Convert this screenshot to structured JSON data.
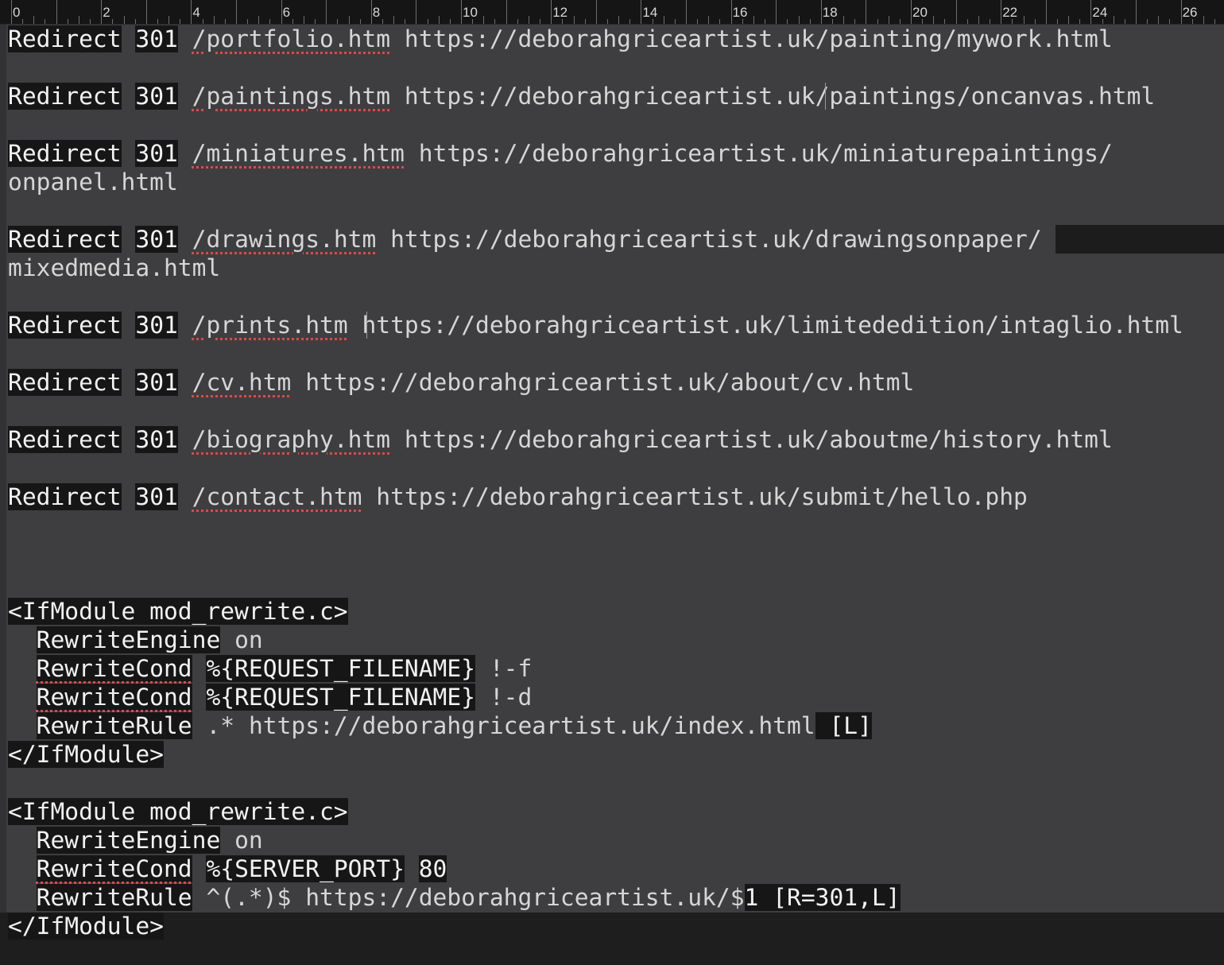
{
  "ruler": {
    "labels": [
      "0",
      "2",
      "4",
      "6",
      "8",
      "10",
      "12",
      "14",
      "16",
      "18",
      "20",
      "22",
      "24",
      "26"
    ]
  },
  "redirects": [
    {
      "keyword": "Redirect",
      "code": "301",
      "path": "/portfolio.htm",
      "url": "https://deborahgriceartist.uk/painting/mywork.html"
    },
    {
      "keyword": "Redirect",
      "code": "301",
      "path": "/paintings.htm",
      "url": "https://deborahgriceartist.uk/paintings/oncanvas.html"
    },
    {
      "keyword": "Redirect",
      "code": "301",
      "path": "/miniatures.htm",
      "url": "https://deborahgriceartist.uk/miniaturepaintings/",
      "wrap": "onpanel.html"
    },
    {
      "keyword": "Redirect",
      "code": "301",
      "path": "/drawings.htm",
      "url": "https://deborahgriceartist.uk/drawingsonpaper/",
      "wrap": "mixedmedia.html"
    },
    {
      "keyword": "Redirect",
      "code": "301",
      "path": "/prints.htm",
      "url": "https://deborahgriceartist.uk/limitededition/intaglio.html"
    },
    {
      "keyword": "Redirect",
      "code": "301",
      "path": "/cv.htm",
      "url": "https://deborahgriceartist.uk/about/cv.html"
    },
    {
      "keyword": "Redirect",
      "code": "301",
      "path": "/biography.htm",
      "url": "https://deborahgriceartist.uk/aboutme/history.html"
    },
    {
      "keyword": "Redirect",
      "code": "301",
      "path": "/contact.htm",
      "url": "https://deborahgriceartist.uk/submit/hello.php"
    }
  ],
  "block1": {
    "open": "<IfModule mod_rewrite.c>",
    "engine": {
      "directive": "RewriteEngine",
      "value": "on"
    },
    "cond1": {
      "directive": "RewriteCond",
      "var": "%{REQUEST_FILENAME}",
      "test": "!-f"
    },
    "cond2": {
      "directive": "RewriteCond",
      "var": "%{REQUEST_FILENAME}",
      "test": "!-d"
    },
    "rule": {
      "directive": "RewriteRule",
      "pattern": ".*",
      "target": "https://deborahgriceartist.uk/index.html",
      "flags": "[L]"
    },
    "close": "</IfModule>"
  },
  "block2": {
    "open": "<IfModule mod_rewrite.c>",
    "engine": {
      "directive": "RewriteEngine",
      "value": "on"
    },
    "cond": {
      "directive": "RewriteCond",
      "var": "%{SERVER_PORT}",
      "value": "80"
    },
    "rule": {
      "directive": "RewriteRule",
      "pattern": "^(.*)$",
      "target": "https://deborahgriceartist.uk/$",
      "suffix": "1",
      "flags": "[R=301,L]"
    },
    "close": "</IfModule>"
  }
}
